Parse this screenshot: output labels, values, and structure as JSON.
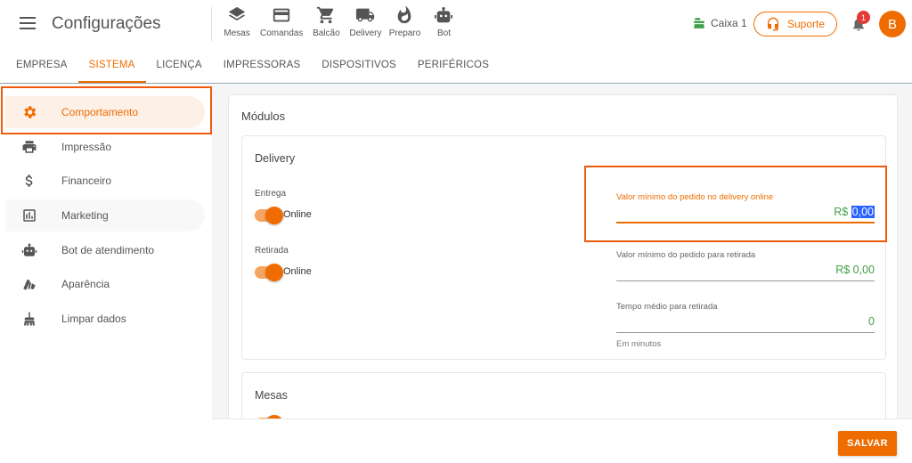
{
  "header": {
    "title": "Configurações",
    "nav": [
      {
        "label": "Mesas",
        "icon": "layers-icon"
      },
      {
        "label": "Comandas",
        "icon": "card-icon"
      },
      {
        "label": "Balcão",
        "icon": "cart-icon"
      },
      {
        "label": "Delivery",
        "icon": "truck-icon"
      },
      {
        "label": "Preparo",
        "icon": "fire-icon"
      },
      {
        "label": "Bot",
        "icon": "robot-icon"
      }
    ],
    "caixa_label": "Caixa 1",
    "suporte_label": "Suporte",
    "notification_count": "1",
    "avatar_initial": "B"
  },
  "tabs": [
    {
      "label": "EMPRESA"
    },
    {
      "label": "SISTEMA"
    },
    {
      "label": "LICENÇA"
    },
    {
      "label": "IMPRESSORAS"
    },
    {
      "label": "DISPOSITIVOS"
    },
    {
      "label": "PERIFÉRICOS"
    }
  ],
  "sidebar": {
    "items": [
      {
        "label": "Comportamento",
        "icon": "gear-icon"
      },
      {
        "label": "Impressão",
        "icon": "printer-icon"
      },
      {
        "label": "Financeiro",
        "icon": "dollar-icon"
      },
      {
        "label": "Marketing",
        "icon": "chart-icon"
      },
      {
        "label": "Bot de atendimento",
        "icon": "robot-icon"
      },
      {
        "label": "Aparência",
        "icon": "palette-icon"
      },
      {
        "label": "Limpar dados",
        "icon": "broom-icon"
      }
    ]
  },
  "main": {
    "title": "Módulos",
    "delivery": {
      "title": "Delivery",
      "entrega_label": "Entrega",
      "entrega_state": "Online",
      "retirada_label": "Retirada",
      "retirada_state": "Online",
      "min_delivery_label": "Valor mínimo do pedido no delivery online",
      "min_delivery_currency": "R$",
      "min_delivery_value": "0,00",
      "min_retirada_label": "Valor mínimo do pedido para retirada",
      "min_retirada_value": "R$ 0,00",
      "tempo_label": "Tempo médio para retirada",
      "tempo_value": "0",
      "tempo_hint": "Em minutos"
    },
    "mesas": {
      "title": "Mesas"
    }
  },
  "footer": {
    "save_label": "SALVAR"
  },
  "colors": {
    "accent": "#ef6c00",
    "value_green": "#43a047",
    "highlight_box": "#ef5b0c"
  }
}
